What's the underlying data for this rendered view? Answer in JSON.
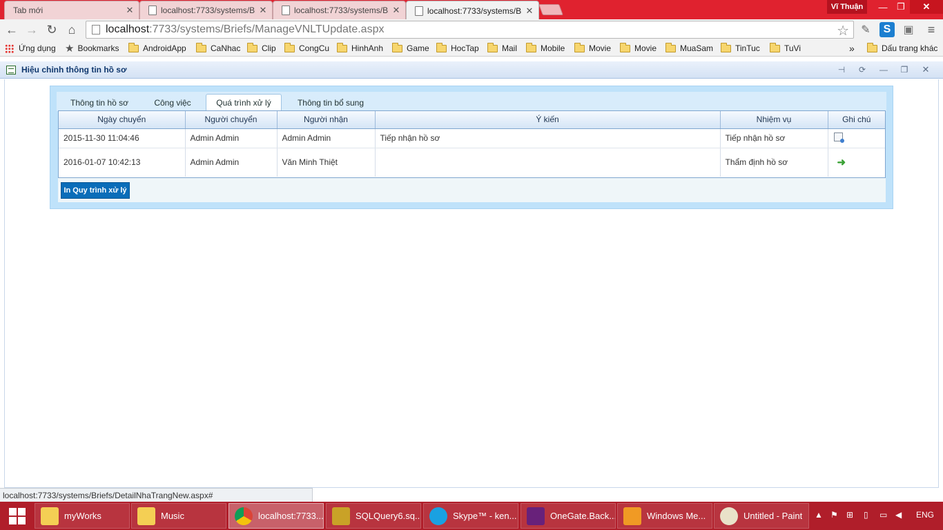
{
  "browser": {
    "tabs": [
      {
        "label": "Tab mới",
        "active": false
      },
      {
        "label": "localhost:7733/systems/Br",
        "active": false
      },
      {
        "label": "localhost:7733/systems/Br",
        "active": false
      },
      {
        "label": "localhost:7733/systems/Br",
        "active": true
      }
    ],
    "profile_name": "Vĩ Thuận",
    "url_host": "localhost",
    "url_path": ":7733/systems/Briefs/ManageVNLTUpdate.aspx",
    "bookmarks": [
      {
        "label": "Ứng dụng",
        "icon": "apps-grid-icon"
      },
      {
        "label": "Bookmarks",
        "icon": "star-icon"
      },
      {
        "label": "AndroidApp",
        "icon": "folder-icon"
      },
      {
        "label": "CaNhac",
        "icon": "folder-icon"
      },
      {
        "label": "Clip",
        "icon": "folder-icon"
      },
      {
        "label": "CongCu",
        "icon": "folder-icon"
      },
      {
        "label": "HinhAnh",
        "icon": "folder-icon"
      },
      {
        "label": "Game",
        "icon": "folder-icon"
      },
      {
        "label": "HocTap",
        "icon": "folder-icon"
      },
      {
        "label": "Mail",
        "icon": "folder-icon"
      },
      {
        "label": "Mobile",
        "icon": "folder-icon"
      },
      {
        "label": "Movie",
        "icon": "folder-icon"
      },
      {
        "label": "Movie",
        "icon": "folder-icon"
      },
      {
        "label": "MuaSam",
        "icon": "folder-icon"
      },
      {
        "label": "TinTuc",
        "icon": "folder-icon"
      },
      {
        "label": "TuVi",
        "icon": "folder-icon"
      }
    ],
    "bookmarks_overflow": "»",
    "other_bookmarks": "Dấu trang khác",
    "status_url": "localhost:7733/systems/Briefs/DetailNhaTrangNew.aspx#"
  },
  "panel": {
    "title": "Hiệu chỉnh thông tin hồ sơ",
    "tabs": [
      {
        "label": "Thông tin hồ sơ",
        "active": false
      },
      {
        "label": "Công việc",
        "active": false
      },
      {
        "label": "Quá trình xử lý",
        "active": true
      },
      {
        "label": "Thông tin bổ sung",
        "active": false
      }
    ],
    "columns": [
      "Ngày chuyển",
      "Người chuyển",
      "Người nhận",
      "Ý kiến",
      "Nhiệm vụ",
      "Ghi chú"
    ],
    "rows": [
      {
        "date": "2015-11-30 11:04:46",
        "sender": "Admin Admin",
        "receiver": "Admin Admin",
        "opinion": "Tiếp nhận hồ sơ",
        "task": "Tiếp nhận hồ sơ",
        "note_icon": "note-icon"
      },
      {
        "date": "2016-01-07 10:42:13",
        "sender": "Admin Admin",
        "receiver": "Văn Minh Thiệt",
        "opinion": "",
        "task": "Thẩm định hồ sơ",
        "note_icon": "arrow-right-icon"
      }
    ],
    "print_button": "In Quy trình xử lý"
  },
  "taskbar": {
    "items": [
      {
        "label": "myWorks",
        "icon": "folder-icon",
        "active": false
      },
      {
        "label": "Music",
        "icon": "folder-icon",
        "active": false
      },
      {
        "label": "localhost:7733...",
        "icon": "chrome-icon",
        "active": true
      },
      {
        "label": "SQLQuery6.sq...",
        "icon": "sql-server-icon",
        "active": false
      },
      {
        "label": "Skype™ - ken...",
        "icon": "skype-icon",
        "active": false
      },
      {
        "label": "OneGate.Back...",
        "icon": "visual-studio-icon",
        "active": false
      },
      {
        "label": "Windows Me...",
        "icon": "windows-media-icon",
        "active": false
      },
      {
        "label": "Untitled - Paint",
        "icon": "paint-icon",
        "active": false
      }
    ],
    "language": "ENG"
  },
  "colors": {
    "chrome_frame": "#e0222f",
    "taskbar": "#b01e2a",
    "tab_container": "#bfe2fa",
    "print_button": "#0a6db9"
  }
}
